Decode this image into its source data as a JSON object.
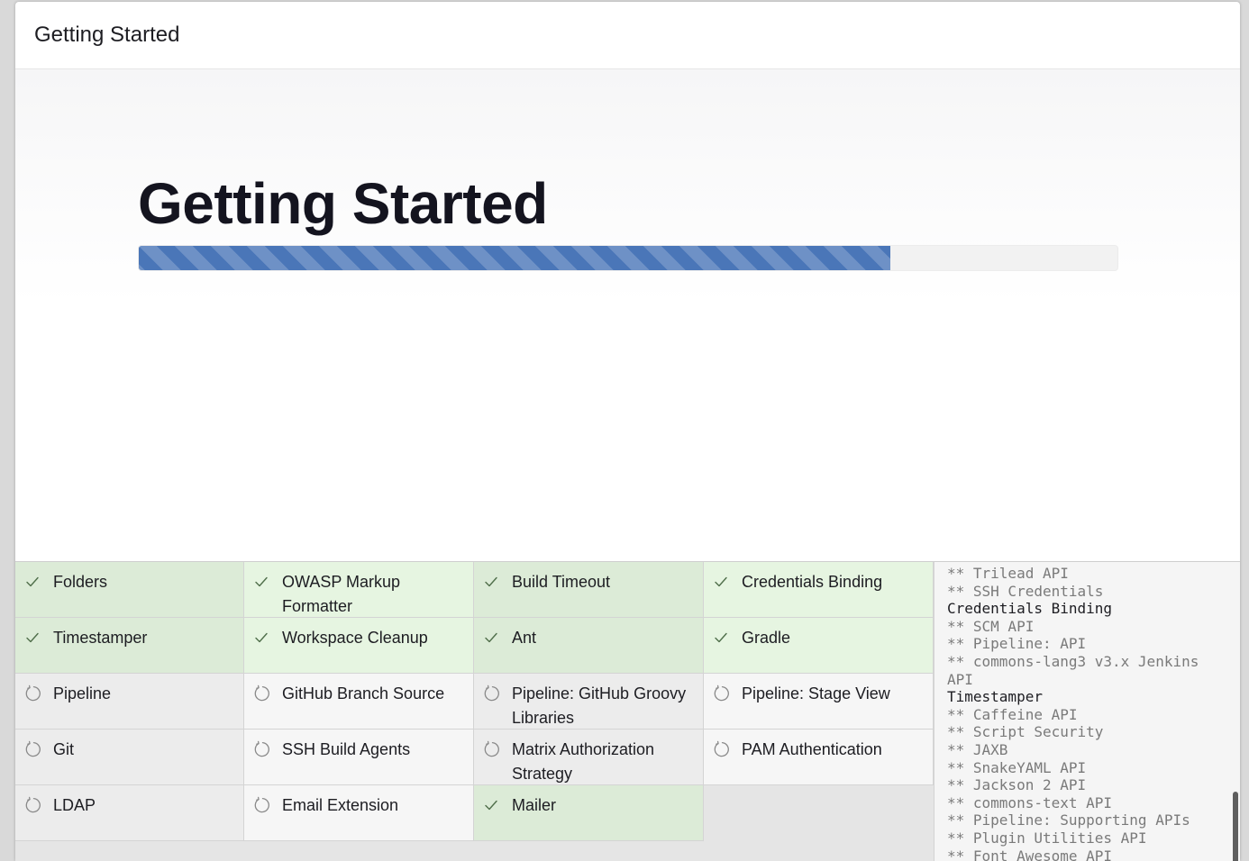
{
  "header": {
    "title": "Getting Started"
  },
  "hero": {
    "title": "Getting Started",
    "progress_fraction": 0.768
  },
  "plugins": [
    {
      "name": "Folders",
      "status": "success"
    },
    {
      "name": "OWASP Markup Formatter",
      "status": "success"
    },
    {
      "name": "Build Timeout",
      "status": "success"
    },
    {
      "name": "Credentials Binding",
      "status": "success"
    },
    {
      "name": "Timestamper",
      "status": "success"
    },
    {
      "name": "Workspace Cleanup",
      "status": "success"
    },
    {
      "name": "Ant",
      "status": "success"
    },
    {
      "name": "Gradle",
      "status": "success"
    },
    {
      "name": "Pipeline",
      "status": "pending"
    },
    {
      "name": "GitHub Branch Source",
      "status": "pending"
    },
    {
      "name": "Pipeline: GitHub Groovy Libraries",
      "status": "pending"
    },
    {
      "name": "Pipeline: Stage View",
      "status": "pending"
    },
    {
      "name": "Git",
      "status": "pending"
    },
    {
      "name": "SSH Build Agents",
      "status": "pending"
    },
    {
      "name": "Matrix Authorization Strategy",
      "status": "pending"
    },
    {
      "name": "PAM Authentication",
      "status": "pending"
    },
    {
      "name": "LDAP",
      "status": "pending"
    },
    {
      "name": "Email Extension",
      "status": "pending"
    },
    {
      "name": "Mailer",
      "status": "success"
    }
  ],
  "log": [
    {
      "text": "** Trilead API",
      "dep": true
    },
    {
      "text": "** SSH Credentials",
      "dep": true
    },
    {
      "text": "Credentials Binding",
      "dep": false
    },
    {
      "text": "** SCM API",
      "dep": true
    },
    {
      "text": "** Pipeline: API",
      "dep": true
    },
    {
      "text": "** commons-lang3 v3.x Jenkins API",
      "dep": true
    },
    {
      "text": "Timestamper",
      "dep": false
    },
    {
      "text": "** Caffeine API",
      "dep": true
    },
    {
      "text": "** Script Security",
      "dep": true
    },
    {
      "text": "** JAXB",
      "dep": true
    },
    {
      "text": "** SnakeYAML API",
      "dep": true
    },
    {
      "text": "** Jackson 2 API",
      "dep": true
    },
    {
      "text": "** commons-text API",
      "dep": true
    },
    {
      "text": "** Pipeline: Supporting APIs",
      "dep": true
    },
    {
      "text": "** Plugin Utilities API",
      "dep": true
    },
    {
      "text": "** Font Awesome API",
      "dep": true
    }
  ],
  "icons": {
    "success": "check-icon",
    "pending": "refresh-icon"
  },
  "colors": {
    "progress": "#4a76b8",
    "success_bg": "#dcebd7",
    "pending_bg": "#ececec",
    "title": "#14141f"
  }
}
